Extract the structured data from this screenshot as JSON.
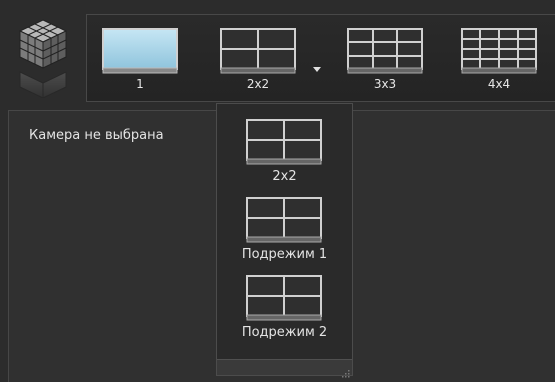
{
  "toolbar": {
    "buttons": [
      {
        "label": "1",
        "icon": "single-view-icon"
      },
      {
        "label": "2x2",
        "icon": "grid-2x2-icon"
      },
      {
        "label": "3x3",
        "icon": "grid-3x3-icon"
      },
      {
        "label": "4x4",
        "icon": "grid-4x4-icon"
      }
    ],
    "dropdown_icon": "chevron-down-icon"
  },
  "main": {
    "placeholder": "Камера не выбрана"
  },
  "dropdown": {
    "items": [
      {
        "label": "2x2",
        "icon": "grid-2x2-icon"
      },
      {
        "label": "Подрежим 1",
        "icon": "grid-2x2-icon"
      },
      {
        "label": "Подрежим 2",
        "icon": "grid-2x2-icon"
      }
    ]
  },
  "colors": {
    "background": "#2c2c2c",
    "panel": "#303030",
    "border": "#474747",
    "text": "#e4e4e4",
    "single_view_fill": "#a9d6ea"
  }
}
